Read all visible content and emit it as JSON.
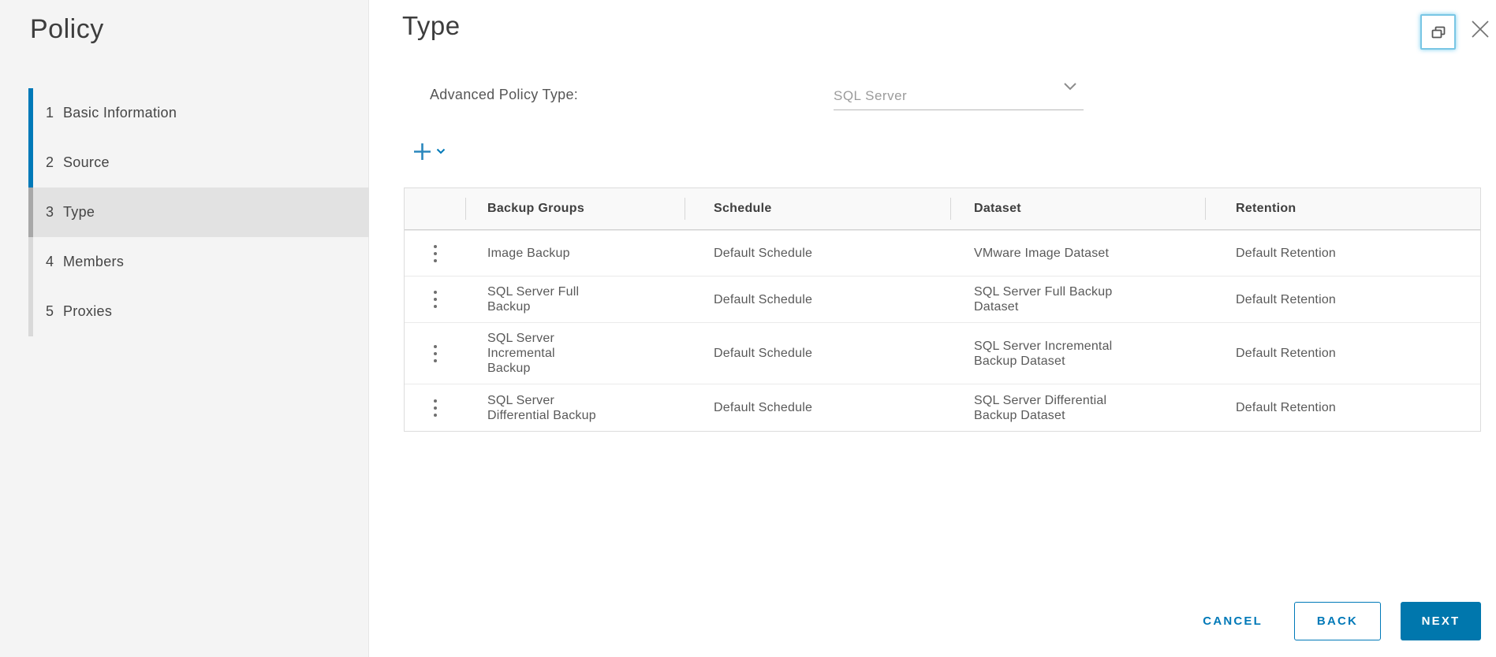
{
  "dialog": {
    "title": "Policy",
    "content_title": "Type"
  },
  "wizard_steps": {
    "items": [
      {
        "number": "1",
        "label": "Basic Information",
        "state": "completed"
      },
      {
        "number": "2",
        "label": "Source",
        "state": "completed"
      },
      {
        "number": "3",
        "label": "Type",
        "state": "current"
      },
      {
        "number": "4",
        "label": "Members",
        "state": "upcoming"
      },
      {
        "number": "5",
        "label": "Proxies",
        "state": "upcoming"
      }
    ]
  },
  "form": {
    "advanced_policy_type_label": "Advanced Policy Type:",
    "advanced_policy_type_value": "SQL Server"
  },
  "table": {
    "columns": [
      "Backup Groups",
      "Schedule",
      "Dataset",
      "Retention"
    ],
    "rows": [
      {
        "backup_group": "Image Backup",
        "schedule": "Default Schedule",
        "dataset": "VMware Image Dataset",
        "retention": "Default Retention"
      },
      {
        "backup_group": "SQL Server Full\nBackup",
        "schedule": "Default Schedule",
        "dataset": "SQL Server Full Backup\nDataset",
        "retention": "Default Retention"
      },
      {
        "backup_group": "SQL Server\nIncremental\nBackup",
        "schedule": "Default Schedule",
        "dataset": "SQL Server Incremental\nBackup Dataset",
        "retention": "Default Retention"
      },
      {
        "backup_group": "SQL Server\nDifferential Backup",
        "schedule": "Default Schedule",
        "dataset": "SQL Server Differential\nBackup Dataset",
        "retention": "Default Retention"
      }
    ]
  },
  "footer": {
    "cancel_label": "CANCEL",
    "back_label": "BACK",
    "next_label": "NEXT"
  },
  "icons": {
    "add": "plus",
    "add_caret": "chevron-down",
    "select_caret": "chevron-down",
    "row_menu": "kebab-vertical-dots",
    "window": "window-restore",
    "close": "x"
  },
  "colors": {
    "accent_blue": "#0079b8",
    "primary_button_blue": "#0077ad",
    "sidebar_background": "#f4f4f4",
    "active_step_background": "#e2e2e2",
    "table_header_background": "#f9f9f9",
    "focus_ring_blue": "#79c6e4"
  }
}
